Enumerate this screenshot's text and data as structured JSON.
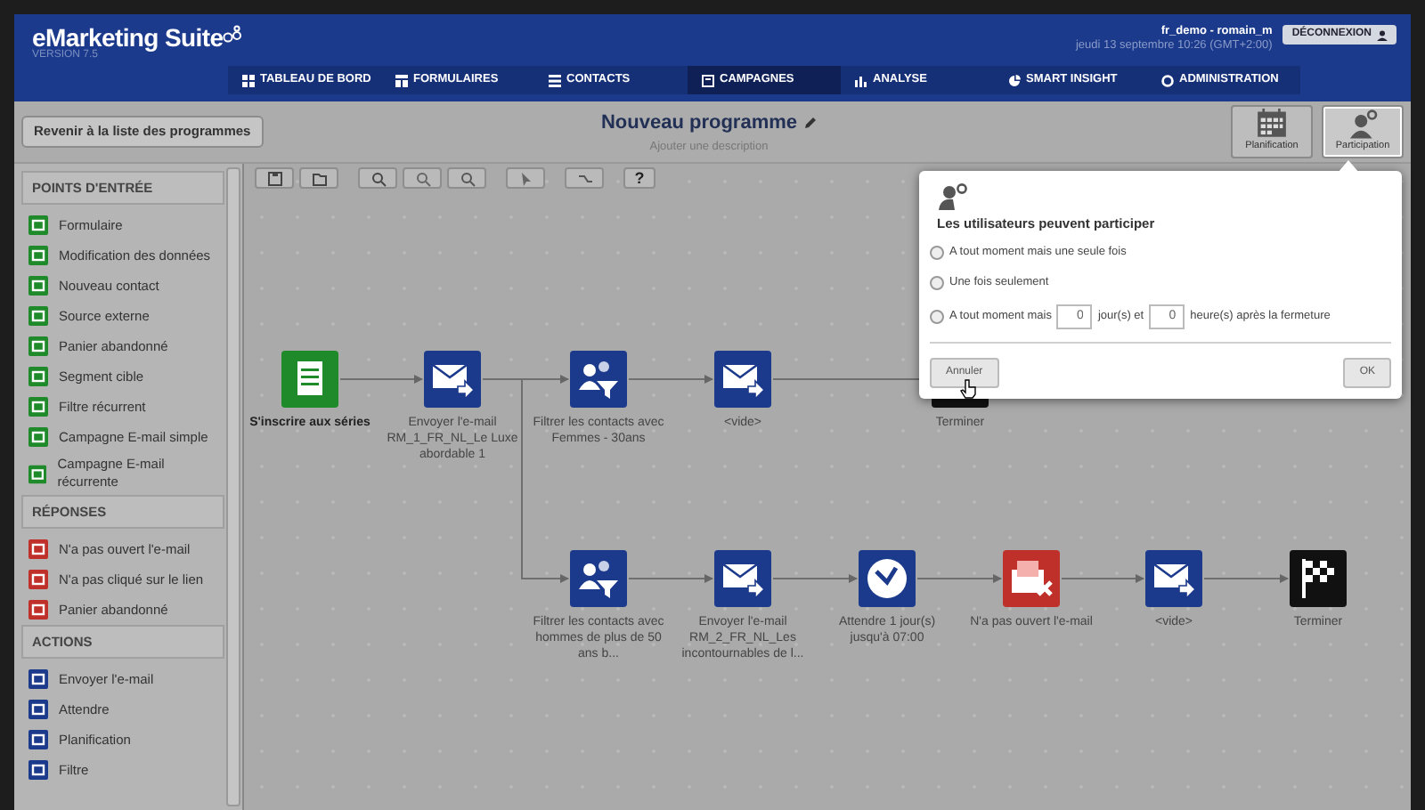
{
  "header": {
    "logo": "eMarketing Suite",
    "version": "VERSION 7.5",
    "user": "fr_demo - romain_m",
    "datetime": "jeudi 13 septembre 10:26 (GMT+2:00)",
    "logout": "DÉCONNEXION"
  },
  "nav": [
    {
      "label": "TABLEAU DE BORD",
      "kind": "dashboard",
      "selected": false
    },
    {
      "label": "FORMULAIRES",
      "kind": "forms",
      "selected": false
    },
    {
      "label": "CONTACTS",
      "kind": "contacts",
      "selected": false
    },
    {
      "label": "CAMPAGNES",
      "kind": "campaigns",
      "selected": true
    },
    {
      "label": "ANALYSE",
      "kind": "analysis",
      "selected": false
    },
    {
      "label": "SMART INSIGHT",
      "kind": "insight",
      "selected": false
    },
    {
      "label": "ADMINISTRATION",
      "kind": "admin",
      "selected": false
    }
  ],
  "back_button": "Revenir à la liste des programmes",
  "program": {
    "title": "Nouveau programme",
    "description": "Ajouter une description"
  },
  "tool_buttons": [
    {
      "label": "Planification",
      "kind": "calendar",
      "selected": false
    },
    {
      "label": "Participation",
      "kind": "participation",
      "selected": true
    }
  ],
  "canvas_toolbar": [
    {
      "kind": "save"
    },
    {
      "kind": "open"
    },
    {
      "kind": "zoom-in"
    },
    {
      "kind": "zoom-out"
    },
    {
      "kind": "zoom-reset"
    },
    {
      "kind": "pointer"
    },
    {
      "kind": "connector"
    },
    {
      "kind": "help",
      "label": "?"
    }
  ],
  "sidebar": {
    "sections": [
      {
        "title": "POINTS D'ENTRÉE",
        "kind": "entry",
        "items": [
          "Formulaire",
          "Modification des données",
          "Nouveau contact",
          "Source externe",
          "Panier abandonné",
          "Segment cible",
          "Filtre récurrent",
          "Campagne E-mail simple",
          "Campagne E-mail récurrente"
        ]
      },
      {
        "title": "RÉPONSES",
        "kind": "response",
        "items": [
          "N'a pas ouvert l'e-mail",
          "N'a pas cliqué sur le lien",
          "Panier abandonné"
        ]
      },
      {
        "title": "ACTIONS",
        "kind": "action",
        "items": [
          "Envoyer l'e-mail",
          "Attendre",
          "Planification",
          "Filtre"
        ]
      }
    ]
  },
  "nodes": [
    {
      "kind": "form",
      "label": "S'inscrire aux séries"
    },
    {
      "kind": "email",
      "label": "Envoyer l'e-mail RM_1_FR_NL_Le Luxe abordable 1"
    },
    {
      "kind": "filter",
      "label": "Filtrer les contacts avec Femmes - 30ans"
    },
    {
      "kind": "email",
      "label": "<vide>"
    },
    {
      "kind": "end",
      "label": "Terminer"
    },
    {
      "kind": "filter",
      "label": "Filtrer les contacts avec hommes de plus de 50 ans b..."
    },
    {
      "kind": "email",
      "label": "Envoyer l'e-mail RM_2_FR_NL_Les incontournables de l..."
    },
    {
      "kind": "wait",
      "label": "Attendre 1 jour(s) jusqu'à 07:00"
    },
    {
      "kind": "no-open",
      "label": "N'a pas ouvert l'e-mail"
    },
    {
      "kind": "email",
      "label": "<vide>"
    },
    {
      "kind": "end",
      "label": "Terminer"
    }
  ],
  "popover": {
    "title": "Les utilisateurs peuvent participer",
    "options": [
      {
        "kind": "plain",
        "label": "A tout moment mais une seule fois",
        "selected": false
      },
      {
        "kind": "plain",
        "label": "Une fois seulement",
        "selected": false
      },
      {
        "kind": "delay",
        "label": "A tout moment mais",
        "days": "0",
        "days_label": "jour(s) et",
        "hours": "0",
        "hours_label": "heure(s) après la fermeture",
        "selected": false
      }
    ],
    "buttons": [
      "Annuler",
      "OK"
    ]
  }
}
